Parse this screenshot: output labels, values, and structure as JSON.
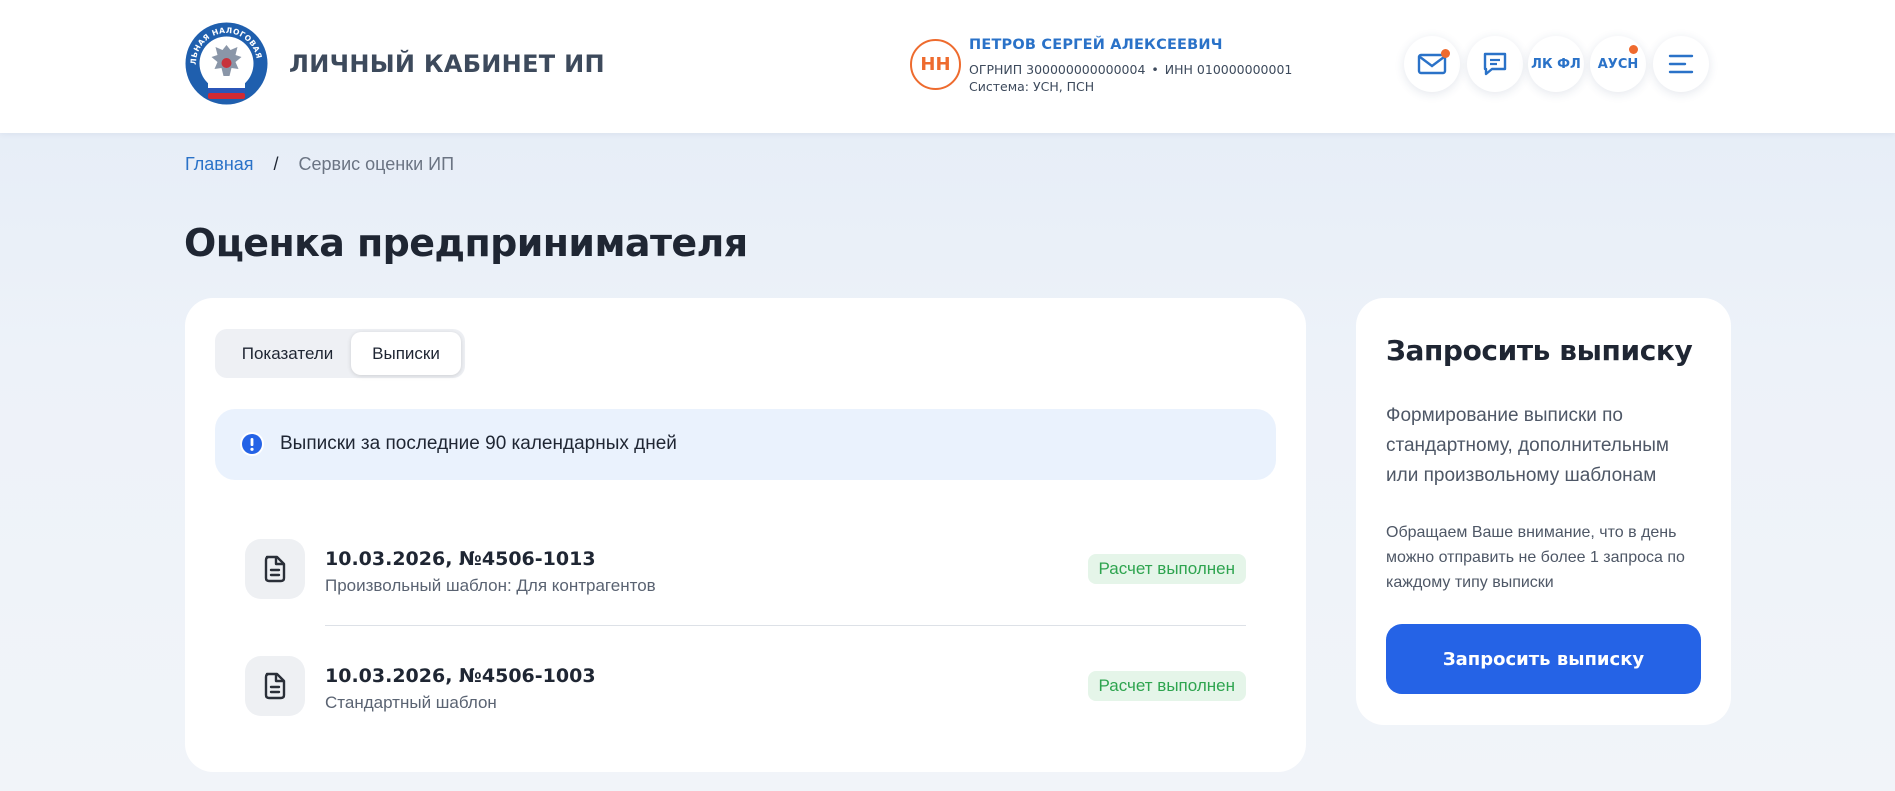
{
  "header": {
    "logo_text": "ФЕДЕРАЛЬНАЯ НАЛОГОВАЯ СЛУЖБА",
    "app_title": "ЛИЧНЫЙ КАБИНЕТ ИП",
    "user": {
      "initials": "НН",
      "name": "ПЕТРОВ СЕРГЕЙ АЛЕКСЕЕВИЧ",
      "ogrnip": "ОГРНИП 300000000000004",
      "separator": "•",
      "inn": "ИНН 010000000001",
      "system": "Система: УСН, ПСН"
    },
    "buttons": {
      "lk_fl": "ЛК ФЛ",
      "ausn": "АУСН"
    },
    "accent_color": "#2a72c8",
    "notification_color": "#ef6a2e"
  },
  "breadcrumb": {
    "home": "Главная",
    "separator": "/",
    "current": "Сервис оценки ИП"
  },
  "page_title": "Оценка предпринимателя",
  "tabs": {
    "indicators": "Показатели",
    "statements": "Выписки",
    "active": "Выписки"
  },
  "info_banner": {
    "text": "Выписки за последние 90 календарных дней"
  },
  "statements": [
    {
      "title": "10.03.2026, №4506-1013",
      "subtitle": "Произвольный шаблон: Для контрагентов",
      "status": "Расчет выполнен"
    },
    {
      "title": "10.03.2026, №4506-1003",
      "subtitle": "Стандартный шаблон",
      "status": "Расчет выполнен"
    }
  ],
  "side_card": {
    "title": "Запросить выписку",
    "description": "Формирование выписки по стандартному, дополнительным или произвольному шаблонам",
    "note": "Обращаем Ваше внимание, что в день можно отправить не более 1 запроса по каждому типу выписки",
    "button_label": "Запросить выписку",
    "button_color": "#2563e6"
  },
  "status_color": "#2ea44f"
}
